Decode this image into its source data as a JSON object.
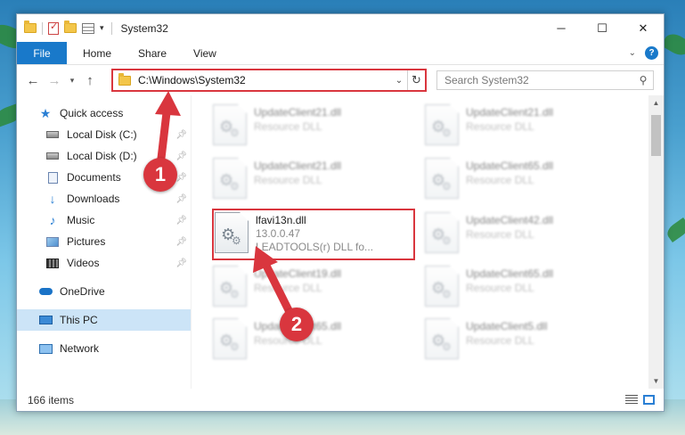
{
  "window": {
    "title": "System32",
    "minimize_icon": "minimize-icon",
    "maximize_icon": "maximize-icon",
    "close_icon": "close-icon"
  },
  "ribbon": {
    "tabs": [
      "File",
      "Home",
      "Share",
      "View"
    ]
  },
  "navbar": {
    "address": "C:\\Windows\\System32",
    "search_placeholder": "Search System32"
  },
  "sidebar": {
    "quick_access": "Quick access",
    "items": [
      {
        "label": "Local Disk (C:)",
        "icon": "disk-icon",
        "pinned": true
      },
      {
        "label": "Local Disk (D:)",
        "icon": "disk-icon",
        "pinned": true
      },
      {
        "label": "Documents",
        "icon": "documents-icon",
        "pinned": true
      },
      {
        "label": "Downloads",
        "icon": "downloads-icon",
        "pinned": true
      },
      {
        "label": "Music",
        "icon": "music-icon",
        "pinned": true
      },
      {
        "label": "Pictures",
        "icon": "pictures-icon",
        "pinned": true
      },
      {
        "label": "Videos",
        "icon": "videos-icon",
        "pinned": true
      }
    ],
    "onedrive": "OneDrive",
    "this_pc": "This PC",
    "network": "Network"
  },
  "files": [
    {
      "name": "UpdateClient21.dll",
      "desc": "Resource DLL"
    },
    {
      "name": "UpdateClient21.dll",
      "desc": "Resource DLL"
    },
    {
      "name": "UpdateClient21.dll",
      "desc": "Resource DLL"
    },
    {
      "name": "UpdateClient65.dll",
      "desc": "Resource DLL"
    },
    {
      "name": "lfavi13n.dll",
      "version": "13.0.0.47",
      "desc": "LEADTOOLS(r) DLL fo..."
    },
    {
      "name": "UpdateClient42.dll",
      "desc": "Resource DLL"
    },
    {
      "name": "UpdateClient19.dll",
      "desc": "Resource DLL"
    },
    {
      "name": "UpdateClient65.dll",
      "desc": "Resource DLL"
    },
    {
      "name": "UpdateClient65.dll",
      "desc": "Resource DLL"
    },
    {
      "name": "UpdateClient5.dll",
      "desc": "Resource DLL"
    }
  ],
  "status": {
    "item_count": "166 items"
  },
  "annotations": {
    "step1": "1",
    "step2": "2",
    "color": "#d9363e"
  }
}
